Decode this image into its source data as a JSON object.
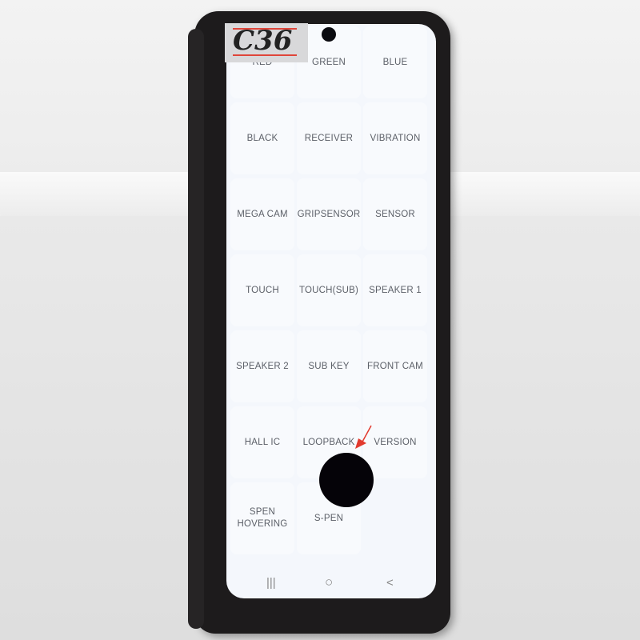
{
  "sticker_label": "C36",
  "test_menu": {
    "items": [
      {
        "label": "RED",
        "row": 0,
        "col": 0
      },
      {
        "label": "GREEN",
        "row": 0,
        "col": 1
      },
      {
        "label": "BLUE",
        "row": 0,
        "col": 2
      },
      {
        "label": "BLACK",
        "row": 1,
        "col": 0
      },
      {
        "label": "RECEIVER",
        "row": 1,
        "col": 1
      },
      {
        "label": "VIBRATION",
        "row": 1,
        "col": 2
      },
      {
        "label": "MEGA CAM",
        "row": 2,
        "col": 0
      },
      {
        "label": "GRIPSENSOR",
        "row": 2,
        "col": 1
      },
      {
        "label": "SENSOR",
        "row": 2,
        "col": 2
      },
      {
        "label": "TOUCH",
        "row": 3,
        "col": 0
      },
      {
        "label": "TOUCH(SUB)",
        "row": 3,
        "col": 1
      },
      {
        "label": "SPEAKER 1",
        "row": 3,
        "col": 2
      },
      {
        "label": "SPEAKER 2",
        "row": 4,
        "col": 0
      },
      {
        "label": "SUB KEY",
        "row": 4,
        "col": 1
      },
      {
        "label": "FRONT CAM",
        "row": 4,
        "col": 2
      },
      {
        "label": "HALL IC",
        "row": 5,
        "col": 0
      },
      {
        "label": "LOOPBACK",
        "row": 5,
        "col": 1
      },
      {
        "label": "VERSION",
        "row": 5,
        "col": 2
      },
      {
        "label": "SPEN\nHOVERING",
        "row": 6,
        "col": 0
      },
      {
        "label": "S-PEN",
        "row": 6,
        "col": 1
      }
    ]
  },
  "navbar": {
    "recents_icon": "|||",
    "home_icon": "○",
    "back_icon": "<"
  }
}
